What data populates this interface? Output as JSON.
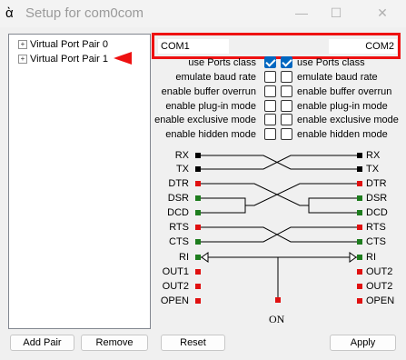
{
  "window": {
    "title": "Setup for com0com",
    "minimize_glyph": "—",
    "maximize_glyph": "☐",
    "close_glyph": "✕"
  },
  "tree": {
    "expander_glyph": "+",
    "items": [
      {
        "label": "Virtual Port Pair 0"
      },
      {
        "label": "Virtual Port Pair 1",
        "selected": true
      }
    ]
  },
  "ports": {
    "left": "COM1",
    "right": "COM2"
  },
  "options": [
    {
      "label": "use Ports class",
      "left_checked": true,
      "right_checked": true
    },
    {
      "label": "emulate baud rate",
      "left_checked": false,
      "right_checked": false
    },
    {
      "label": "enable buffer overrun",
      "left_checked": false,
      "right_checked": false
    },
    {
      "label": "enable plug-in mode",
      "left_checked": false,
      "right_checked": false
    },
    {
      "label": "enable exclusive mode",
      "left_checked": false,
      "right_checked": false
    },
    {
      "label": "enable hidden mode",
      "left_checked": false,
      "right_checked": false
    }
  ],
  "signals": {
    "left": [
      "RX",
      "TX",
      "DTR",
      "DSR",
      "DCD",
      "RTS",
      "CTS",
      "RI",
      "OUT1",
      "OUT2",
      "OPEN"
    ],
    "right": [
      "RX",
      "TX",
      "DTR",
      "DSR",
      "DCD",
      "RTS",
      "CTS",
      "RI",
      "OUT2",
      "OUT2",
      "OPEN"
    ],
    "on_label": "ON",
    "colors": {
      "input": "#1e7d1e",
      "output": "#e01010",
      "data": "#000000",
      "alert": "#ee1111"
    }
  },
  "buttons": {
    "add_pair": "Add Pair",
    "remove": "Remove",
    "reset": "Reset",
    "apply": "Apply"
  }
}
